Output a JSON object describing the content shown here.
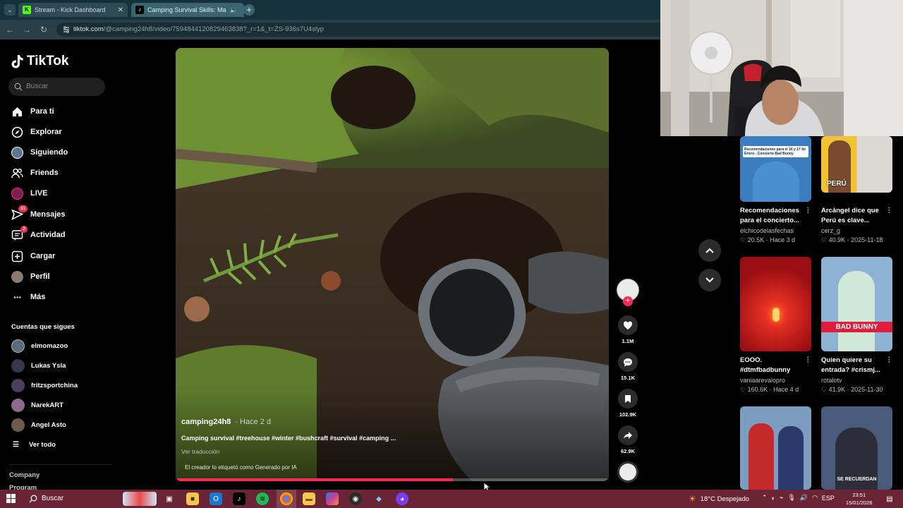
{
  "browser": {
    "tabs": [
      {
        "title": "Stream - Kick Dashboard",
        "favicon_color": "#53fc18"
      },
      {
        "title": "Camping Survival Skills: Ma",
        "favicon_color": "#000000"
      }
    ],
    "url_host": "tiktok.com",
    "url_path": "/@camping24h8/video/7594844120829463838?_r=1&_t=ZS-936s7U4slyp"
  },
  "sidebar": {
    "logo": "TikTok",
    "search_placeholder": "Buscar",
    "nav": [
      {
        "label": "Para ti",
        "icon": "home-icon"
      },
      {
        "label": "Explorar",
        "icon": "compass-icon"
      },
      {
        "label": "Siguiendo",
        "icon": "following-avatar-icon"
      },
      {
        "label": "Friends",
        "icon": "friends-icon"
      },
      {
        "label": "LIVE",
        "icon": "live-icon"
      },
      {
        "label": "Mensajes",
        "icon": "messages-icon",
        "badge": "11"
      },
      {
        "label": "Actividad",
        "icon": "activity-icon",
        "badge": "2"
      },
      {
        "label": "Cargar",
        "icon": "upload-icon"
      },
      {
        "label": "Perfil",
        "icon": "profile-icon"
      },
      {
        "label": "Más",
        "icon": "more-icon"
      }
    ],
    "following_title": "Cuentas que sigues",
    "following": [
      {
        "name": "elmomazoo",
        "color": "#5b6b7a"
      },
      {
        "name": "Lukas Ysla",
        "color": "#34384a"
      },
      {
        "name": "fritzsportchina",
        "color": "#4a3f5c"
      },
      {
        "name": "NarekART",
        "color": "#8c6a8e"
      },
      {
        "name": "Angel Asto",
        "color": "#6f5a4c"
      }
    ],
    "see_all": "Ver todo",
    "footer": [
      "Company",
      "Program"
    ]
  },
  "video": {
    "username": "camping24h8",
    "date": "· Hace 2 d",
    "description": "Camping survival #treehouse #winter #bushcraft #survival #camping ...",
    "translate": "Ver traducción",
    "ai_label": "El creador lo etiquetó como Generado por IA",
    "progress": 0.64
  },
  "actions": {
    "likes": "1.1M",
    "comments": "15.1K",
    "saves": "102.9K",
    "shares": "62.9K"
  },
  "related": [
    {
      "title": "Recomendaciones para el concierto...",
      "author": "elchicodelasfechas",
      "likes": "20.5K",
      "date": "Hace 3 d",
      "thumb_text": "Recomendaciones para el 16 y 17 de Enero - Concierto Bad Bunny",
      "bg": "#2f6fa8"
    },
    {
      "title": "Arcángel dice que Perú es clave...",
      "author": "cerz_g",
      "likes": "40.9K",
      "date": "2025-11-18",
      "thumb_text": "PERÚ",
      "bg": "#e0b325"
    },
    {
      "title": "EOOO. #dtmfbadbunny",
      "author": "vaniaarevalopro",
      "likes": "160.6K",
      "date": "Hace 4 d",
      "thumb_text": "",
      "bg": "#b3121b"
    },
    {
      "title": "Quien quiere su entrada? #crismj...",
      "author": "rotalotv",
      "likes": "41.9K",
      "date": "2025-11-30",
      "thumb_text": "BAD BUNNY",
      "bg": "#7aa3c9"
    },
    {
      "title": "",
      "author": "",
      "likes": "",
      "date": "",
      "thumb_text": "",
      "bg": "#6d8fb5"
    },
    {
      "title": "",
      "author": "",
      "likes": "",
      "date": "",
      "thumb_text": "SE RECUERDAN",
      "bg": "#3d4a6a"
    }
  ],
  "taskbar": {
    "search": "Buscar",
    "weather": "18°C Despejado",
    "lang": "ESP",
    "time": "23:51",
    "date": "15/01/2026"
  }
}
